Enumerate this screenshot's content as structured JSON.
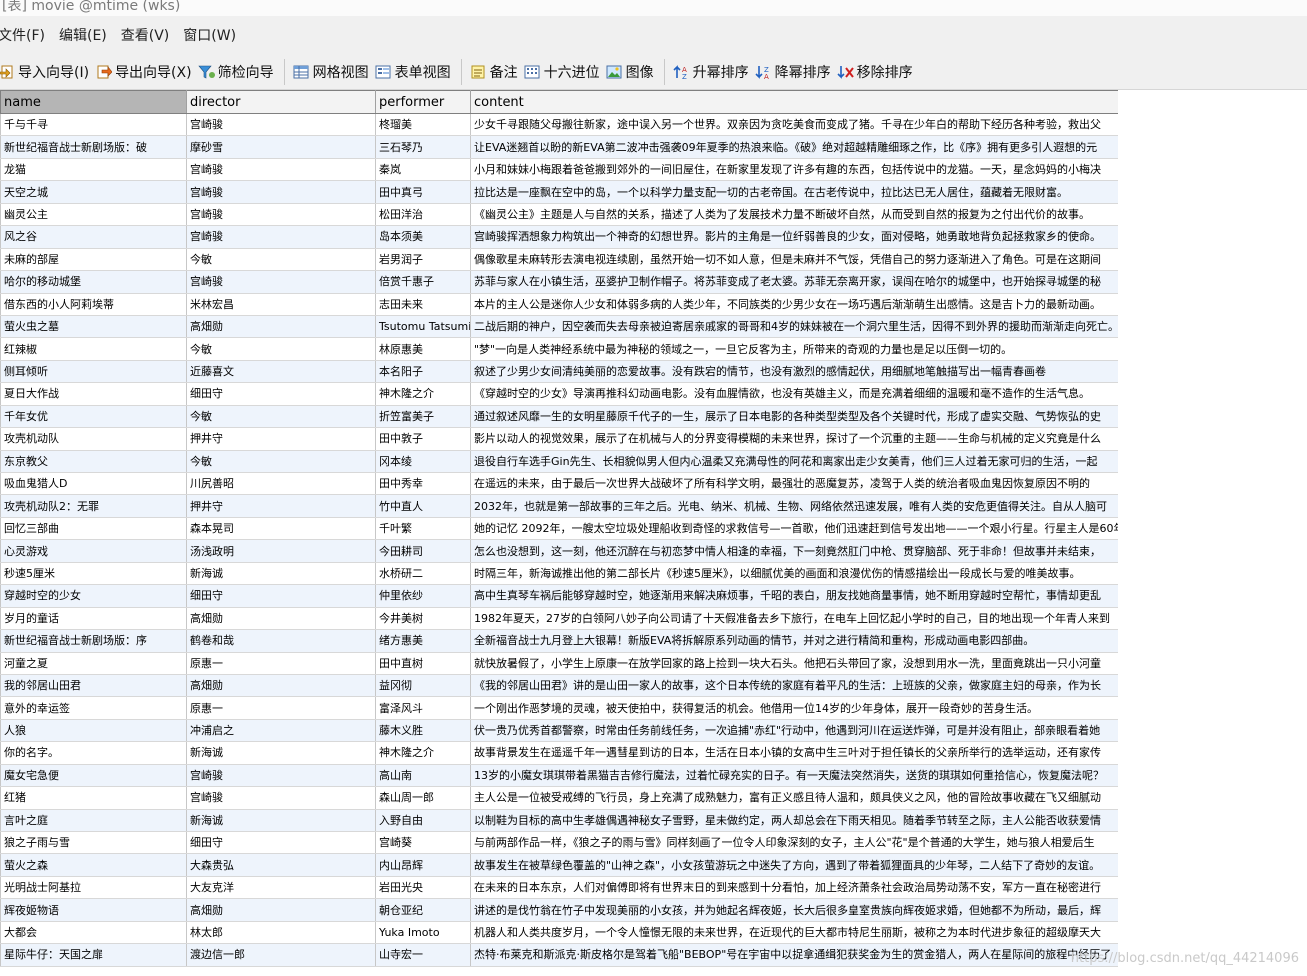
{
  "window": {
    "title": "[表] movie @mtime (wks)"
  },
  "menu": [
    "文件(F)",
    "编辑(E)",
    "查看(V)",
    "窗口(W)"
  ],
  "toolbar": {
    "import_wizard": "导入向导(I)",
    "export_wizard": "导出向导(X)",
    "filter_wizard": "筛检向导",
    "grid_view": "网格视图",
    "form_view": "表单视图",
    "memo": "备注",
    "hex": "十六进位",
    "image": "图像",
    "sort_asc": "升幂排序",
    "sort_desc": "降幂排序",
    "remove_sort": "移除排序"
  },
  "columns": [
    "name",
    "director",
    "performer",
    "content"
  ],
  "rows": [
    [
      "千与千寻",
      "宫崎骏",
      "柊瑠美",
      "少女千寻跟随父母搬往新家，途中误入另一个世界。双亲因为贪吃美食而变成了猪。千寻在少年白的帮助下经历各种考验，救出父"
    ],
    [
      "新世纪福音战士新剧场版：破",
      "摩砂雪",
      "三石琴乃",
      "让EVA迷翘首以盼的新EVA第二波冲击强袭09年夏季的热浪来临。《破》绝对超越精雕细琢之作，比《序》拥有更多引人遐想的元"
    ],
    [
      "龙猫",
      "宫崎骏",
      "秦岚",
      "小月和妹妹小梅跟着爸爸搬到郊外的一间旧屋住，在新家里发现了许多有趣的东西，包括传说中的龙猫。一天，星念妈妈的小梅决"
    ],
    [
      "天空之城",
      "宫崎骏",
      "田中真弓",
      "拉比达是一座飘在空中的岛，一个以科学力量支配一切的古老帝国。在古老传说中，拉比达已无人居住，蕴藏着无限财富。"
    ],
    [
      "幽灵公主",
      "宫崎骏",
      "松田洋治",
      "《幽灵公主》主题是人与自然的关系，描述了人类为了发展技术力量不断破坏自然，从而受到自然的报复为之付出代价的故事。"
    ],
    [
      "风之谷",
      "宫崎骏",
      "岛本须美",
      "宫崎骏挥洒想象力构筑出一个神奇的幻想世界。影片的主角是一位纤弱善良的少女，面对侵略，她勇敢地背负起拯救家乡的使命。"
    ],
    [
      "未麻的部屋",
      "今敏",
      "岩男润子",
      "偶像歌星未麻转形去演电视连续剧，虽然开始一切不如人意，但是未麻并不气馁，凭借自己的努力逐渐进入了角色。可是在这期间"
    ],
    [
      "哈尔的移动城堡",
      "宫崎骏",
      "倍赏千惠子",
      "苏菲与家人在小镇生活，巫婆护卫制作帽子。将苏菲变成了老太婆。苏菲无奈离开家，误闯在哈尔的城堡中，也开始探寻城堡的秘"
    ],
    [
      "借东西的小人阿莉埃蒂",
      "米林宏昌",
      "志田未来",
      "本片的主人公是迷你人少女和体弱多病的人类少年，不同族类的少男少女在一场巧遇后渐渐萌生出感情。这是吉卜力的最新动画。"
    ],
    [
      "萤火虫之墓",
      "高畑勋",
      "Tsutomu Tatsumi",
      "二战后期的神户，因空袭而失去母亲被迫寄居亲戚家的哥哥和4岁的妹妹被在一个洞穴里生活，因得不到外界的援助而渐渐走向死亡。"
    ],
    [
      "红辣椒",
      "今敏",
      "林原惠美",
      "\"梦\"一向是人类神经系统中最为神秘的领域之一，一旦它反客为主，所带来的奇观的力量也是足以压倒一切的。"
    ],
    [
      "侧耳倾听",
      "近藤喜文",
      "本名阳子",
      "叙述了少男少女间清纯美丽的恋爱故事。没有跌宕的情节，也没有激烈的感情起伏，用细腻地笔触描写出一幅青春画卷"
    ],
    [
      "夏日大作战",
      "细田守",
      "神木隆之介",
      "《穿越时空的少女》导演再推科幻动画电影。没有血腥情欲，也没有英雄主义，而是充满着细细的温暖和毫不造作的生活气息。"
    ],
    [
      "千年女优",
      "今敏",
      "折笠富美子",
      "通过叙述风靡一生的女明星藤原千代子的一生，展示了日本电影的各种类型类型及各个关键时代，形成了虚实交融、气势恢弘的史"
    ],
    [
      "攻壳机动队",
      "押井守",
      "田中敦子",
      "影片以动人的视觉效果，展示了在机械与人的分界变得模糊的未来世界，探讨了一个沉重的主题——生命与机械的定义究竟是什么"
    ],
    [
      "东京教父",
      "今敏",
      "冈本绫",
      "退役自行车选手Gin先生、长相貌似男人但内心温柔又充满母性的阿花和离家出走少女美青，他们三人过着无家可归的生活，一起"
    ],
    [
      "吸血鬼猎人D",
      "川尻善昭",
      "田中秀幸",
      "在遥远的未来，由于最后一次世界大战破坏了所有科学文明，最强壮的恶魔复苏，凌驾于人类的统治者吸血鬼因恢复原因不明的"
    ],
    [
      "攻壳机动队2：无罪",
      "押井守",
      "竹中直人",
      "2032年，也就是第一部故事的三年之后。光电、纳米、机械、生物、网络依然迅速发展，唯有人类的安危更值得关注。自从人脑可"
    ],
    [
      "回忆三部曲",
      "森本晃司",
      "千叶繁",
      "她的记忆 2092年，一艘太空垃圾处理船收到奇怪的求救信号—一首歌，他们迅速赶到信号发出地——一个艰小行星。行星主人是60年"
    ],
    [
      "心灵游戏",
      "汤浅政明",
      "今田耕司",
      "怎么也没想到，这一刻，他还沉醉在与初恋梦中情人相逢的幸福，下一刻竟然肛门中枪、贯穿脑部、死于非命！但故事并未结束，"
    ],
    [
      "秒速5厘米",
      "新海诚",
      "水桥研二",
      "时隔三年，新海诚推出他的第二部长片《秒速5厘米》，以细腻优美的画面和浪漫优伤的情感描绘出一段成长与爱的唯美故事。"
    ],
    [
      "穿越时空的少女",
      "细田守",
      "仲里依纱",
      "高中生真琴车祸后能够穿越时空，她逐渐用来解决麻烦事，千昭的表白，朋友找她商量事情，她不断用穿越时空帮忙，事情却更乱"
    ],
    [
      "岁月的童话",
      "高畑勋",
      "今井美树",
      "1982年夏天，27岁的白领阿八妙子向公司请了十天假准备去乡下旅行，在电车上回忆起小学时的自己，目的地出现一个年青人来到"
    ],
    [
      "新世纪福音战士新剧场版：序",
      "鹤卷和哉",
      "绪方惠美",
      "全新福音战士九月登上大银幕！新版EVA将拆解原系列动画的情节，并对之进行精简和重构，形成动画电影四部曲。"
    ],
    [
      "河童之夏",
      "原惠一",
      "田中直树",
      "就快放暑假了，小学生上原康一在放学回家的路上捡到一块大石头。他把石头带回了家，没想到用水一洗，里面竟跳出一只小河童"
    ],
    [
      "我的邻居山田君",
      "高畑勋",
      "益冈彻",
      "《我的邻居山田君》讲的是山田一家人的故事，这个日本传统的家庭有着平凡的生活：上班族的父亲，做家庭主妇的母亲，作为长"
    ],
    [
      "意外的幸运签",
      "原惠一",
      "富泽风斗",
      "一个刚出作恶梦境的灵魂，被天使拍中，获得复活的机会。他借用一位14岁的少年身体，展开一段奇妙的苦身生活。"
    ],
    [
      "人狼",
      "冲浦启之",
      "藤木义胜",
      "伏一贵乃优秀首都警察，时常由任务前线任务，一次追捕\"赤红\"行动中，他遇到河川在运送炸弹，可是并没有阻止，部亲眼看着她"
    ],
    [
      "你的名字。",
      "新海诚",
      "神木隆之介",
      "故事背景发生在遥遥千年一遇彗星到访的日本，生活在日本小镇的女高中生三叶对于担任镇长的父亲所举行的选举运动，还有家传"
    ],
    [
      "魔女宅急便",
      "宫崎骏",
      "高山南",
      "13岁的小魔女琪琪带着黑猫吉吉修行魔法，过着忙碌充实的日子。有一天魔法突然消失，送货的琪琪如何重拾信心，恢复魔法呢？"
    ],
    [
      "红猪",
      "宫崎骏",
      "森山周一郎",
      "主人公是一位被受戒缚的飞行员，身上充满了成熟魅力，富有正义感且待人温和，颇具侠义之风，他的冒险故事收藏在飞又细腻动"
    ],
    [
      "言叶之庭",
      "新海诚",
      "入野自由",
      "以制鞋为目标的高中生孝雄偶遇神秘女子雪野，星未做约定，两人却总会在下雨天相见。随着季节转至之际，主人公能否收获爱情"
    ],
    [
      "狼之子雨与雪",
      "细田守",
      "宫崎葵",
      "与前两部作品一样，《狼之子的雨与雪》同样刻画了一位令人印象深刻的女子，主人公\"花\"是个普通的大学生，她与狼人相爱后生"
    ],
    [
      "萤火之森",
      "大森贵弘",
      "内山昂辉",
      "故事发生在被草绿色覆盖的\"山神之森\"，小女孩萤游玩之中迷失了方向，遇到了带着狐狸面具的少年琴，二人结下了奇妙的友谊。"
    ],
    [
      "光明战士阿基拉",
      "大友克洋",
      "岩田光央",
      "在未来的日本东京，人们对偏傅即将有世界末日的到来感到十分看怕，加上经济萧条社会政治局势动荡不安，军方一直在秘密进行"
    ],
    [
      "辉夜姬物语",
      "高畑勋",
      "朝仓亚纪",
      "讲述的是伐竹翁在竹子中发现美丽的小女孩，并为她起名辉夜姬，长大后很多皇室贵族向辉夜姬求婚，但她都不为所动，最后，辉"
    ],
    [
      "大都会",
      "林太郎",
      "Yuka Imoto",
      "机器人和人类共度岁月，一个令人憧憬无限的未来世界，在近现代的巨大都市特尼生丽斯，被称之为本时代进步象征的超级摩天大"
    ],
    [
      "星际牛仔：天国之扉",
      "渡边信一郎",
      "山寺宏一",
      "杰特·布莱克和斯派克·斯皮格尔是驾着飞船\"BEBOP\"号在宇宙中以捉拿通缉犯获奖金为生的赏金猎人，两人在星际间的旅程中经历了"
    ]
  ],
  "watermark": "https://blog.csdn.net/qq_44214096"
}
